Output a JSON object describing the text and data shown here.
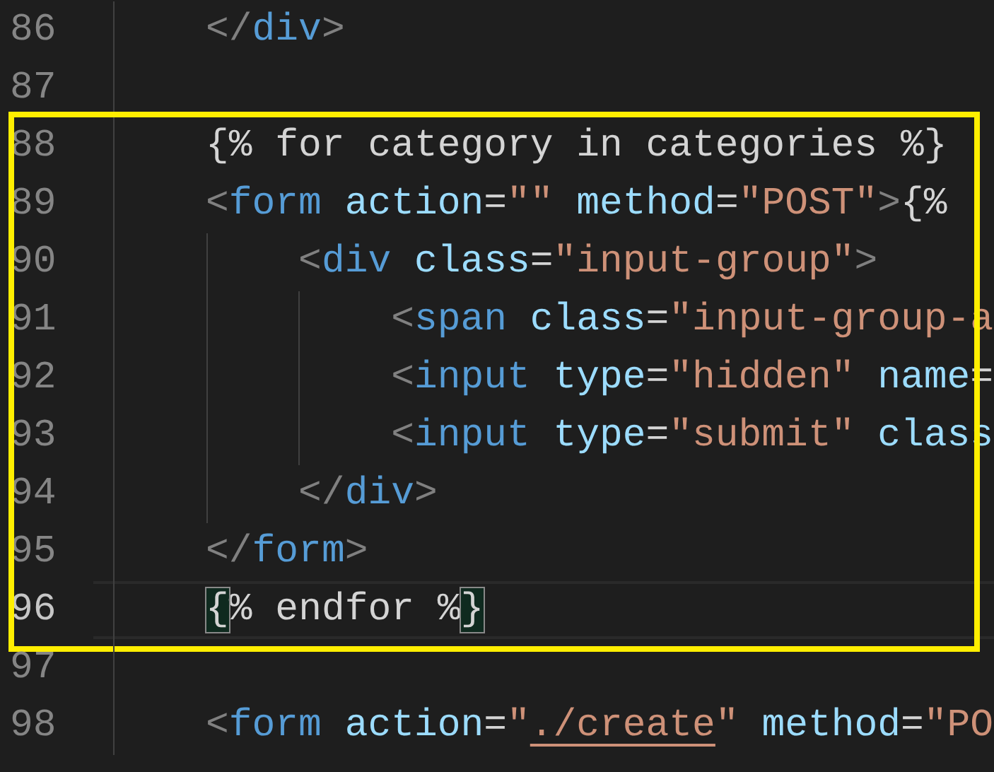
{
  "editor": {
    "lines_before": [
      {
        "number": "86",
        "active": false,
        "tokens": [
          {
            "kind": "punct",
            "text": "    </"
          },
          {
            "kind": "tag",
            "text": "div"
          },
          {
            "kind": "punct",
            "text": ">"
          }
        ]
      },
      {
        "number": "87",
        "active": false
      }
    ],
    "highlighted_lines": [
      {
        "number": "88",
        "active": false,
        "tokens": [
          {
            "kind": "text",
            "text": "    {% for category in categories %}"
          }
        ]
      },
      {
        "number": "89",
        "active": false,
        "tokens": [
          {
            "kind": "punct",
            "text": "    <"
          },
          {
            "kind": "tag",
            "text": "form"
          },
          {
            "kind": "attr",
            "text": " action"
          },
          {
            "kind": "text",
            "text": "="
          },
          {
            "kind": "string",
            "text": "\"\""
          },
          {
            "kind": "attr",
            "text": " method"
          },
          {
            "kind": "text",
            "text": "="
          },
          {
            "kind": "string",
            "text": "\"POST\""
          },
          {
            "kind": "punct",
            "text": ">"
          },
          {
            "kind": "text",
            "text": "{%"
          }
        ]
      },
      {
        "number": "90",
        "active": false,
        "tokens": [
          {
            "kind": "punct",
            "text": "        <"
          },
          {
            "kind": "tag",
            "text": "div"
          },
          {
            "kind": "attr",
            "text": " class"
          },
          {
            "kind": "text",
            "text": "="
          },
          {
            "kind": "string",
            "text": "\"input-group\""
          },
          {
            "kind": "punct",
            "text": ">"
          }
        ]
      },
      {
        "number": "91",
        "active": false,
        "tokens": [
          {
            "kind": "punct",
            "text": "            <"
          },
          {
            "kind": "tag",
            "text": "span"
          },
          {
            "kind": "attr",
            "text": " class"
          },
          {
            "kind": "text",
            "text": "="
          },
          {
            "kind": "string",
            "text": "\"input-group-a"
          }
        ]
      },
      {
        "number": "92",
        "active": false,
        "tokens": [
          {
            "kind": "punct",
            "text": "            <"
          },
          {
            "kind": "tag",
            "text": "input"
          },
          {
            "kind": "attr",
            "text": " type"
          },
          {
            "kind": "text",
            "text": "="
          },
          {
            "kind": "string",
            "text": "\"hidden\""
          },
          {
            "kind": "attr",
            "text": " name"
          },
          {
            "kind": "text",
            "text": "="
          }
        ]
      },
      {
        "number": "93",
        "active": false,
        "tokens": [
          {
            "kind": "punct",
            "text": "            <"
          },
          {
            "kind": "tag",
            "text": "input"
          },
          {
            "kind": "attr",
            "text": " type"
          },
          {
            "kind": "text",
            "text": "="
          },
          {
            "kind": "string",
            "text": "\"submit\""
          },
          {
            "kind": "attr",
            "text": " class"
          }
        ]
      },
      {
        "number": "94",
        "active": false,
        "tokens": [
          {
            "kind": "punct",
            "text": "        </"
          },
          {
            "kind": "tag",
            "text": "div"
          },
          {
            "kind": "punct",
            "text": ">"
          }
        ]
      },
      {
        "number": "95",
        "active": false,
        "tokens": [
          {
            "kind": "punct",
            "text": "    </"
          },
          {
            "kind": "tag",
            "text": "form"
          },
          {
            "kind": "punct",
            "text": ">"
          }
        ]
      },
      {
        "number": "96",
        "active": true,
        "tokens": [
          {
            "kind": "text",
            "text": "    {% endfor %}",
            "matched": true
          }
        ]
      }
    ],
    "lines_after": [
      {
        "number": "97",
        "active": false
      },
      {
        "number": "98",
        "active": false,
        "tokens": [
          {
            "kind": "punct",
            "text": "    <"
          },
          {
            "kind": "tag",
            "text": "form"
          },
          {
            "kind": "attr",
            "text": " action"
          },
          {
            "kind": "text",
            "text": "="
          },
          {
            "kind": "string",
            "text": "\""
          },
          {
            "kind": "string",
            "text": "./create",
            "underline": true
          },
          {
            "kind": "string",
            "text": "\""
          },
          {
            "kind": "attr",
            "text": " method"
          },
          {
            "kind": "text",
            "text": "="
          },
          {
            "kind": "string",
            "text": "\"PO"
          }
        ]
      }
    ]
  }
}
